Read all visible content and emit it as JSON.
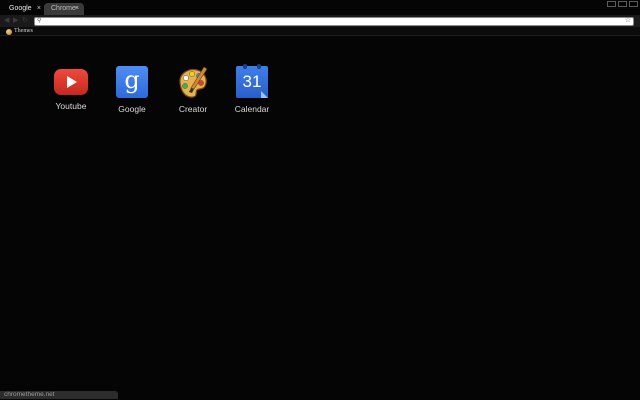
{
  "tabs": [
    {
      "label": "Google",
      "close": "×",
      "active": false
    },
    {
      "label": "Chrome",
      "close": "×",
      "active": true
    }
  ],
  "toolbar": {
    "back": "◀",
    "forward": "▶",
    "reload": "↻",
    "search_icon": "⚲",
    "star_icon": "☆",
    "omnibox_value": ""
  },
  "bookmarks": [
    {
      "label": "Themes",
      "icon": "theme-icon"
    }
  ],
  "apps": [
    {
      "name": "Youtube",
      "icon": "youtube-icon"
    },
    {
      "name": "Google",
      "icon": "google-search-icon",
      "glyph": "g"
    },
    {
      "name": "Creator",
      "icon": "palette-icon"
    },
    {
      "name": "Calendar",
      "icon": "calendar-icon",
      "glyph": "31"
    }
  ],
  "status_bar": {
    "text": "chrometheme.net"
  },
  "colors": {
    "background": "#050505",
    "active_tab": "#3a3a3a",
    "toolbar": "#1a1a1a",
    "youtube_red": "#e53d30",
    "google_blue": "#3b7ae8"
  }
}
